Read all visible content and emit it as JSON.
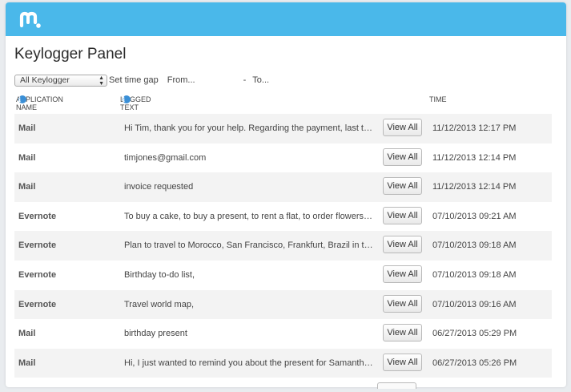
{
  "app": {
    "logo_icon": "mspy-m-logo",
    "accent_color": "#4ab8ea"
  },
  "page": {
    "title": "Keylogger Panel"
  },
  "filters": {
    "select_value": "All Keylogger",
    "time_gap_label": "Set time gap",
    "from_placeholder": "From...",
    "dash": "-",
    "to_placeholder": "To..."
  },
  "columns": {
    "application": "APPLICATION NAME",
    "logged_text": "LOGGED TEXT",
    "time": "TIME",
    "info_icon": "info-icon"
  },
  "rows": [
    {
      "app": "Mail",
      "text": "Hi Tim, thank you for your help. Regarding the payment, last tw...",
      "button": "View All",
      "time": "11/12/2013 12:17 PM"
    },
    {
      "app": "Mail",
      "text": "timjones@gmail.com",
      "button": "View All",
      "time": "11/12/2013 12:14 PM"
    },
    {
      "app": "Mail",
      "text": "invoice requested",
      "button": "View All",
      "time": "11/12/2013 12:14 PM"
    },
    {
      "app": "Evernote",
      "text": "To buy a cake, to buy a present, to rent a flat, to order flowers. ...",
      "button": "View All",
      "time": "07/10/2013 09:21 AM"
    },
    {
      "app": "Evernote",
      "text": "Plan to travel to Morocco, San Francisco, Frankfurt, Brazil in th...",
      "button": "View All",
      "time": "07/10/2013 09:18 AM"
    },
    {
      "app": "Evernote",
      "text": "Birthday to-do list,",
      "button": "View All",
      "time": "07/10/2013 09:18 AM"
    },
    {
      "app": "Evernote",
      "text": "Travel world map,",
      "button": "View All",
      "time": "07/10/2013 09:16 AM"
    },
    {
      "app": "Mail",
      "text": "birthday present",
      "button": "View All",
      "time": "06/27/2013 05:29 PM"
    },
    {
      "app": "Mail",
      "text": "Hi, I just wanted to remind you about the present for Samantha....",
      "button": "View All",
      "time": "06/27/2013 05:26 PM"
    }
  ]
}
